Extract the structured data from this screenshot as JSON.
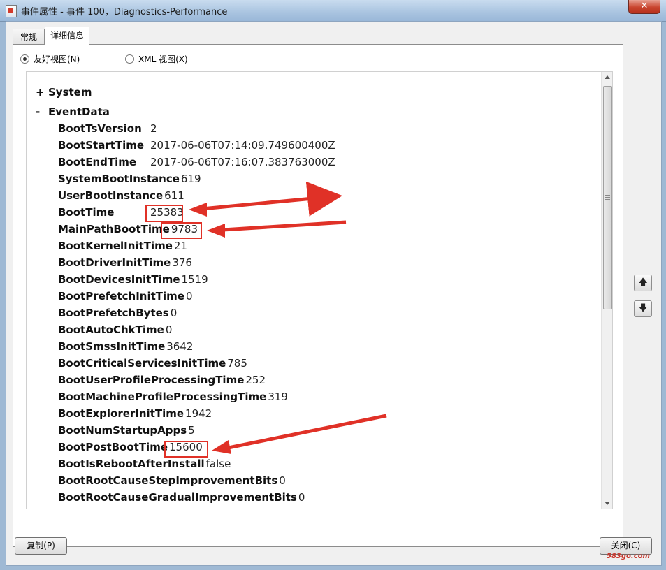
{
  "window": {
    "title": "事件属性 - 事件 100，Diagnostics-Performance",
    "close_glyph": "✕"
  },
  "tabs": [
    {
      "label": "常规"
    },
    {
      "label": "详细信息"
    }
  ],
  "view_options": {
    "friendly": "友好视图(N)",
    "xml": "XML 视图(X)"
  },
  "tree": {
    "system": {
      "sign": "+",
      "label": "System"
    },
    "eventdata": {
      "sign": "-",
      "label": "EventData"
    }
  },
  "rows": [
    {
      "key": "BootTsVersion",
      "value": "2"
    },
    {
      "key": "BootStartTime",
      "value": "2017-06-06T07:14:09.749600400Z"
    },
    {
      "key": "BootEndTime",
      "value": "2017-06-06T07:16:07.383763000Z"
    },
    {
      "key": "SystemBootInstance",
      "value": "619"
    },
    {
      "key": "UserBootInstance",
      "value": "611"
    },
    {
      "key": "BootTime",
      "value": "25383"
    },
    {
      "key": "MainPathBootTime",
      "value": "9783"
    },
    {
      "key": "BootKernelInitTime",
      "value": "21"
    },
    {
      "key": "BootDriverInitTime",
      "value": "376"
    },
    {
      "key": "BootDevicesInitTime",
      "value": "1519"
    },
    {
      "key": "BootPrefetchInitTime",
      "value": "0"
    },
    {
      "key": "BootPrefetchBytes",
      "value": "0"
    },
    {
      "key": "BootAutoChkTime",
      "value": "0"
    },
    {
      "key": "BootSmssInitTime",
      "value": "3642"
    },
    {
      "key": "BootCriticalServicesInitTime",
      "value": "785"
    },
    {
      "key": "BootUserProfileProcessingTime",
      "value": "252"
    },
    {
      "key": "BootMachineProfileProcessingTime",
      "value": "319"
    },
    {
      "key": "BootExplorerInitTime",
      "value": "1942"
    },
    {
      "key": "BootNumStartupApps",
      "value": "5"
    },
    {
      "key": "BootPostBootTime",
      "value": "15600"
    },
    {
      "key": "BootIsRebootAfterInstall",
      "value": "false"
    },
    {
      "key": "BootRootCauseStepImprovementBits",
      "value": "0"
    },
    {
      "key": "BootRootCauseGradualImprovementBits",
      "value": "0"
    }
  ],
  "nav": {
    "up": "🡅",
    "down": "🡇"
  },
  "buttons": {
    "copy": "复制(P)",
    "close": "关闭(C)"
  },
  "watermark": "583go.com",
  "colors": {
    "annotation": "#e03127"
  }
}
